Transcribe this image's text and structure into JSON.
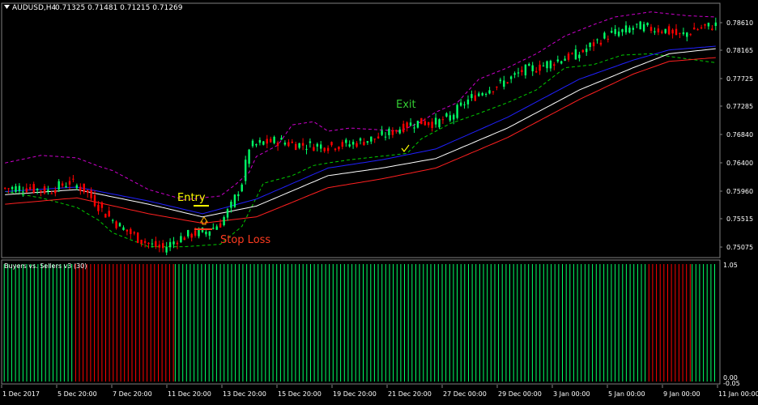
{
  "window": {
    "symbol_label": "AUDUSD,H4",
    "ohlc_label": "0.71325 0.71481 0.71215 0.71269"
  },
  "annotations": {
    "entry": "Entry",
    "exit": "Exit",
    "stop_loss": "Stop Loss"
  },
  "indicator": {
    "title": "Buyers vs. Sellers v3 (30)",
    "scale_top": "1.05",
    "scale_bottom": "0.00",
    "scale_bottom2": "-0.05"
  },
  "colors": {
    "background": "#000000",
    "bull_candle": "#00ff66",
    "bear_candle": "#ff0000",
    "upper_envelope": "#cc00cc",
    "lower_envelope": "#00cc00",
    "blue_ma": "#2020ff",
    "white_ma": "#ffffff",
    "red_ma": "#ff2020",
    "entry_text": "#ffff00",
    "exit_text": "#33cc33",
    "stop_loss_text": "#ff3b1f",
    "axis_text": "#ffffff",
    "grid_line": "#808080"
  },
  "chart_data": [
    {
      "type": "candlestick",
      "symbol": "AUDUSD",
      "timeframe": "H4",
      "y_tick_labels": [
        "0.78610",
        "0.78165",
        "0.77725",
        "0.77285",
        "0.76840",
        "0.76400",
        "0.75960",
        "0.75515",
        "0.75075"
      ],
      "x_tick_labels": [
        "1 Dec 2017",
        "5 Dec 20:00",
        "7 Dec 20:00",
        "11 Dec 20:00",
        "13 Dec 20:00",
        "15 Dec 20:00",
        "19 Dec 20:00",
        "21 Dec 20:00",
        "27 Dec 00:00",
        "29 Dec 00:00",
        "3 Jan 00:00",
        "5 Jan 00:00",
        "9 Jan 00:00",
        "11 Jan 00:00"
      ],
      "close_path": [
        [
          0,
          0.76
        ],
        [
          6,
          0.7601
        ],
        [
          12,
          0.7596
        ],
        [
          18,
          0.761
        ],
        [
          22,
          0.7598
        ],
        [
          28,
          0.756
        ],
        [
          32,
          0.754
        ],
        [
          36,
          0.7525
        ],
        [
          40,
          0.7512
        ],
        [
          44,
          0.7505
        ],
        [
          48,
          0.752
        ],
        [
          52,
          0.7528
        ],
        [
          56,
          0.7532
        ],
        [
          60,
          0.7545
        ],
        [
          63,
          0.7572
        ],
        [
          66,
          0.761
        ],
        [
          68,
          0.7665
        ],
        [
          72,
          0.7672
        ],
        [
          76,
          0.7675
        ],
        [
          80,
          0.767
        ],
        [
          84,
          0.7668
        ],
        [
          90,
          0.7667
        ],
        [
          96,
          0.767
        ],
        [
          100,
          0.7675
        ],
        [
          104,
          0.768
        ],
        [
          108,
          0.769
        ],
        [
          112,
          0.77
        ],
        [
          116,
          0.7705
        ],
        [
          120,
          0.7703
        ],
        [
          124,
          0.7712
        ],
        [
          128,
          0.7735
        ],
        [
          132,
          0.775
        ],
        [
          136,
          0.776
        ],
        [
          140,
          0.777
        ],
        [
          144,
          0.7785
        ],
        [
          148,
          0.779
        ],
        [
          152,
          0.7798
        ],
        [
          156,
          0.7806
        ],
        [
          160,
          0.7812
        ],
        [
          164,
          0.7828
        ],
        [
          168,
          0.7842
        ],
        [
          172,
          0.7847
        ],
        [
          176,
          0.7855
        ],
        [
          180,
          0.7852
        ],
        [
          184,
          0.7849
        ],
        [
          188,
          0.784
        ],
        [
          192,
          0.785
        ],
        [
          196,
          0.7855
        ],
        [
          198,
          0.7857
        ]
      ],
      "moving_averages": [
        {
          "name": "blue",
          "color": "#2020ff",
          "points": [
            [
              0,
              0.7595
            ],
            [
              20,
              0.7602
            ],
            [
              40,
              0.758
            ],
            [
              55,
              0.756
            ],
            [
              70,
              0.7583
            ],
            [
              90,
              0.7632
            ],
            [
              105,
              0.7645
            ],
            [
              120,
              0.7662
            ],
            [
              140,
              0.7712
            ],
            [
              160,
              0.7772
            ],
            [
              175,
              0.7802
            ],
            [
              185,
              0.7818
            ],
            [
              198,
              0.7824
            ]
          ]
        },
        {
          "name": "white",
          "color": "#ffffff",
          "points": [
            [
              0,
              0.759
            ],
            [
              20,
              0.7598
            ],
            [
              40,
              0.7575
            ],
            [
              55,
              0.7555
            ],
            [
              70,
              0.7572
            ],
            [
              90,
              0.762
            ],
            [
              105,
              0.7632
            ],
            [
              120,
              0.7647
            ],
            [
              140,
              0.7695
            ],
            [
              160,
              0.7755
            ],
            [
              175,
              0.779
            ],
            [
              185,
              0.7812
            ],
            [
              198,
              0.782
            ]
          ]
        },
        {
          "name": "red",
          "color": "#ff2020",
          "points": [
            [
              0,
              0.7575
            ],
            [
              20,
              0.7585
            ],
            [
              40,
              0.756
            ],
            [
              55,
              0.7545
            ],
            [
              70,
              0.7555
            ],
            [
              90,
              0.7601
            ],
            [
              105,
              0.7615
            ],
            [
              120,
              0.7632
            ],
            [
              140,
              0.768
            ],
            [
              160,
              0.774
            ],
            [
              175,
              0.778
            ],
            [
              185,
              0.78
            ],
            [
              198,
              0.7806
            ]
          ]
        }
      ],
      "envelopes": [
        {
          "name": "upper",
          "color": "#cc00cc",
          "points": [
            [
              0,
              0.764
            ],
            [
              10,
              0.7652
            ],
            [
              20,
              0.7648
            ],
            [
              26,
              0.7635
            ],
            [
              30,
              0.7628
            ],
            [
              40,
              0.7598
            ],
            [
              50,
              0.7582
            ],
            [
              60,
              0.7588
            ],
            [
              64,
              0.7605
            ],
            [
              68,
              0.7625
            ],
            [
              70,
              0.765
            ],
            [
              76,
              0.7668
            ],
            [
              80,
              0.77
            ],
            [
              86,
              0.7705
            ],
            [
              90,
              0.769
            ],
            [
              96,
              0.7695
            ],
            [
              102,
              0.7693
            ],
            [
              110,
              0.769
            ],
            [
              116,
              0.7705
            ],
            [
              120,
              0.772
            ],
            [
              126,
              0.7735
            ],
            [
              132,
              0.7772
            ],
            [
              140,
              0.779
            ],
            [
              148,
              0.7812
            ],
            [
              156,
              0.784
            ],
            [
              164,
              0.7858
            ],
            [
              170,
              0.787
            ],
            [
              180,
              0.7878
            ],
            [
              190,
              0.7872
            ],
            [
              198,
              0.787
            ]
          ]
        },
        {
          "name": "lower",
          "color": "#00cc00",
          "points": [
            [
              0,
              0.7595
            ],
            [
              10,
              0.7585
            ],
            [
              20,
              0.757
            ],
            [
              26,
              0.755
            ],
            [
              30,
              0.753
            ],
            [
              40,
              0.7508
            ],
            [
              50,
              0.7508
            ],
            [
              60,
              0.7512
            ],
            [
              66,
              0.754
            ],
            [
              72,
              0.7608
            ],
            [
              80,
              0.762
            ],
            [
              86,
              0.7636
            ],
            [
              90,
              0.764
            ],
            [
              96,
              0.7645
            ],
            [
              104,
              0.765
            ],
            [
              112,
              0.7655
            ],
            [
              116,
              0.7678
            ],
            [
              124,
              0.7702
            ],
            [
              132,
              0.7718
            ],
            [
              140,
              0.7735
            ],
            [
              148,
              0.7755
            ],
            [
              156,
              0.779
            ],
            [
              164,
              0.7795
            ],
            [
              172,
              0.781
            ],
            [
              180,
              0.7812
            ],
            [
              190,
              0.7804
            ],
            [
              198,
              0.7798
            ]
          ]
        }
      ]
    },
    {
      "type": "bar",
      "title": "Buyers vs. Sellers v3 (30)",
      "ylim": [
        0,
        1.05
      ],
      "bar_value": 1.05,
      "segments": [
        {
          "from": 0,
          "to": 38,
          "signal": "buy"
        },
        {
          "from": 38,
          "to": 91,
          "signal": "sell"
        },
        {
          "from": 91,
          "to": 343,
          "signal": "buy"
        },
        {
          "from": 343,
          "to": 366,
          "signal": "sell"
        },
        {
          "from": 366,
          "to": 380,
          "signal": "buy"
        }
      ]
    }
  ]
}
